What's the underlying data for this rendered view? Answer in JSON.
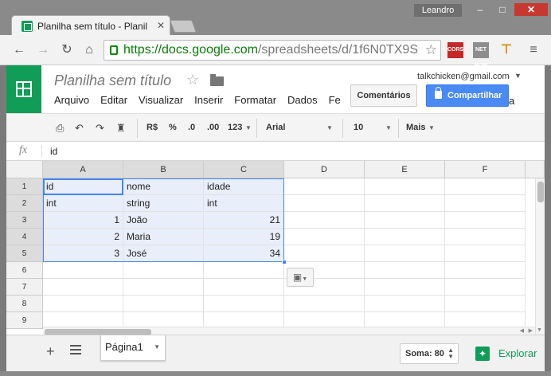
{
  "window": {
    "user": "Leandro",
    "tab_title": "Planilha sem título - Planil",
    "minimize": "–",
    "maximize": "□",
    "close": "✕"
  },
  "browser": {
    "url_host": "https://docs.google.com",
    "url_path": "/spreadsheets/d/1f6N0TX9S",
    "extensions": [
      "CORS",
      "NET NOW"
    ]
  },
  "app": {
    "doc_title": "Planilha sem título",
    "account_email": "talkchicken@gmail.com",
    "menu": [
      "Arquivo",
      "Editar",
      "Visualizar",
      "Inserir",
      "Formatar",
      "Dados",
      "Fe"
    ],
    "menu_tail": "a",
    "comments_label": "Comentários",
    "share_label": "Compartilhar"
  },
  "format_bar": {
    "currency": "R$",
    "percent": "%",
    "dec_less": ".0",
    "dec_more": ".00",
    "number_format": "123",
    "font": "Arial",
    "font_size": "10",
    "more": "Mais"
  },
  "formula_bar": {
    "fx": "fx",
    "value": "id"
  },
  "grid": {
    "columns": [
      "A",
      "B",
      "C",
      "D",
      "E",
      "F"
    ],
    "rows": [
      "1",
      "2",
      "3",
      "4",
      "5",
      "6",
      "7",
      "8",
      "9"
    ],
    "cells": [
      [
        "id",
        "nome",
        "idade"
      ],
      [
        "int",
        "string",
        "int"
      ],
      [
        "1",
        "João",
        "21"
      ],
      [
        "2",
        "Maria",
        "19"
      ],
      [
        "3",
        "José",
        "34"
      ]
    ]
  },
  "bottom_bar": {
    "add_sheet": "+",
    "sheet_tab": "Página1",
    "sum": "Soma: 80",
    "explore": "Explorar"
  }
}
